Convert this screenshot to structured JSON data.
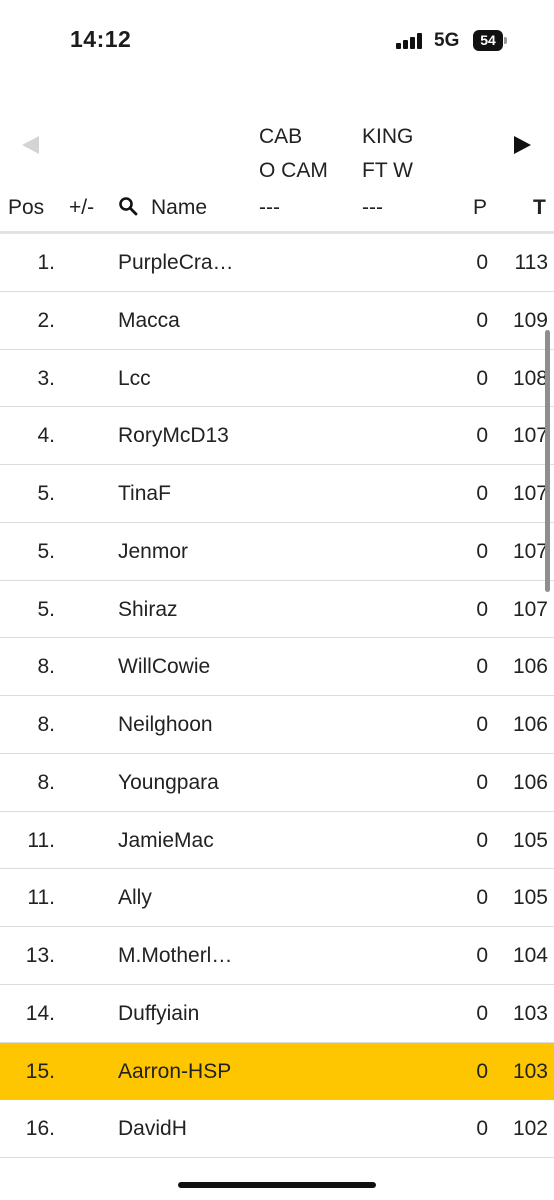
{
  "status_bar": {
    "time": "14:12",
    "network": "5G",
    "battery": "54"
  },
  "columns": {
    "pos": "Pos",
    "change": "+/-",
    "name": "Name",
    "match1": {
      "line1": "CAB",
      "line2": "O CAM",
      "value": "---"
    },
    "match2": {
      "line1": "KING",
      "line2": "FT W",
      "value": "---"
    },
    "points": "P",
    "total": "T"
  },
  "highlight_color": "#fdc600",
  "rows": [
    {
      "pos": "1.",
      "name": "PurpleCra…",
      "p": "0",
      "t": "113"
    },
    {
      "pos": "2.",
      "name": "Macca",
      "p": "0",
      "t": "109"
    },
    {
      "pos": "3.",
      "name": "Lcc",
      "p": "0",
      "t": "108"
    },
    {
      "pos": "4.",
      "name": "RoryMcD13",
      "p": "0",
      "t": "107"
    },
    {
      "pos": "5.",
      "name": "TinaF",
      "p": "0",
      "t": "107"
    },
    {
      "pos": "5.",
      "name": "Jenmor",
      "p": "0",
      "t": "107"
    },
    {
      "pos": "5.",
      "name": "Shiraz",
      "p": "0",
      "t": "107"
    },
    {
      "pos": "8.",
      "name": "WillCowie",
      "p": "0",
      "t": "106"
    },
    {
      "pos": "8.",
      "name": "Neilghoon",
      "p": "0",
      "t": "106"
    },
    {
      "pos": "8.",
      "name": "Youngpara",
      "p": "0",
      "t": "106"
    },
    {
      "pos": "11.",
      "name": "JamieMac",
      "p": "0",
      "t": "105"
    },
    {
      "pos": "11.",
      "name": "Ally",
      "p": "0",
      "t": "105"
    },
    {
      "pos": "13.",
      "name": "M.Motherl…",
      "p": "0",
      "t": "104"
    },
    {
      "pos": "14.",
      "name": "Duffyiain",
      "p": "0",
      "t": "103"
    },
    {
      "pos": "15.",
      "name": "Aarron-HSP",
      "p": "0",
      "t": "103",
      "highlighted": true
    },
    {
      "pos": "16.",
      "name": "DavidH",
      "p": "0",
      "t": "102"
    }
  ]
}
